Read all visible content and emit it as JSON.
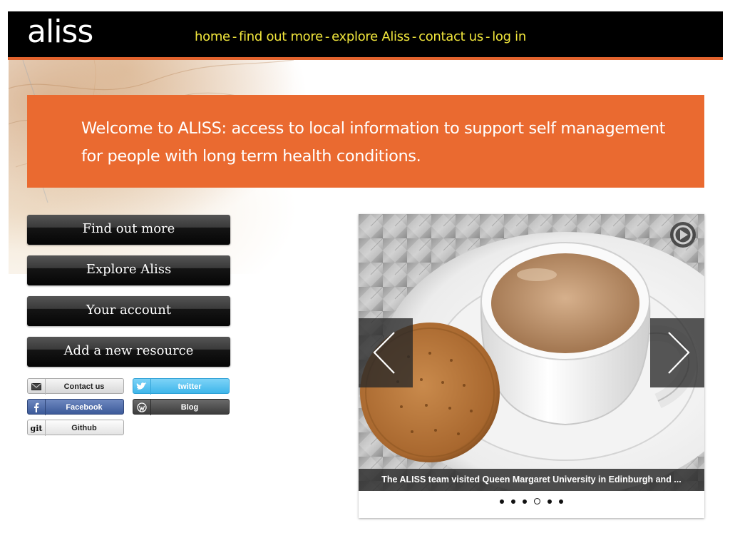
{
  "brand": {
    "logo": "aliss"
  },
  "nav": {
    "items": [
      "home",
      "find out more",
      "explore Aliss",
      "contact us",
      "log in"
    ],
    "separator": "-"
  },
  "banner": {
    "text": "Welcome to ALISS: access to local information to support self management for people with long term health conditions.",
    "background": "#ea6a30"
  },
  "buttons": {
    "find_out_more": "Find out more",
    "explore_aliss": "Explore Aliss",
    "your_account": "Your account",
    "add_resource": "Add a new resource"
  },
  "social": {
    "contact": "Contact us",
    "twitter": "twitter",
    "facebook": "Facebook",
    "blog": "Blog",
    "github": "Github",
    "github_icon_text": "git"
  },
  "slider": {
    "caption": "The ALISS team visited Queen Margaret University in Edinburgh and ...",
    "dots_count": 6,
    "active_dot": 4,
    "image": "tea-cup-and-biscuit"
  },
  "colors": {
    "nav_link": "#f1e63c",
    "accent_orange": "#e2632d",
    "topbar": "#000000"
  }
}
